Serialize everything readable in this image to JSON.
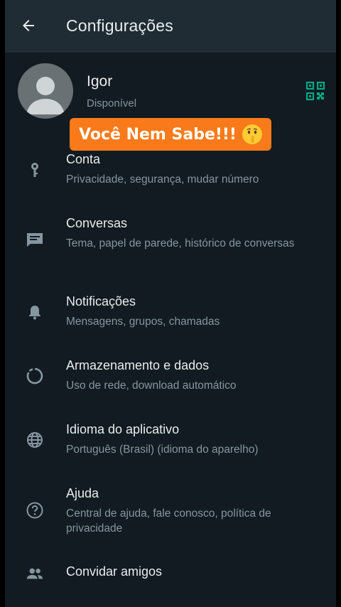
{
  "header": {
    "title": "Configurações"
  },
  "profile": {
    "name": "Igor",
    "status": "Disponível"
  },
  "banner": {
    "text": "Você Nem Sabe!!!",
    "emoji": "shushing-face"
  },
  "items": [
    {
      "label": "Conta",
      "sub": "Privacidade, segurança, mudar número",
      "icon": "key-icon"
    },
    {
      "label": "Conversas",
      "sub": "Tema, papel de parede, histórico de conversas",
      "icon": "chat-icon"
    },
    {
      "label": "Notificações",
      "sub": "Mensagens, grupos, chamadas",
      "icon": "bell-icon"
    },
    {
      "label": "Armazenamento e dados",
      "sub": "Uso de rede, download automático",
      "icon": "storage-icon"
    },
    {
      "label": "Idioma do aplicativo",
      "sub": "Português (Brasil) (idioma do aparelho)",
      "icon": "globe-icon"
    },
    {
      "label": "Ajuda",
      "sub": "Central de ajuda, fale conosco, política de privacidade",
      "icon": "help-icon"
    },
    {
      "label": "Convidar amigos",
      "sub": "",
      "icon": "people-icon"
    }
  ],
  "colors": {
    "background": "#111b21",
    "appbar": "#1f2c34",
    "accent": "#00a884",
    "banner": "#f97a1a",
    "secondary_text": "#8696a0"
  }
}
